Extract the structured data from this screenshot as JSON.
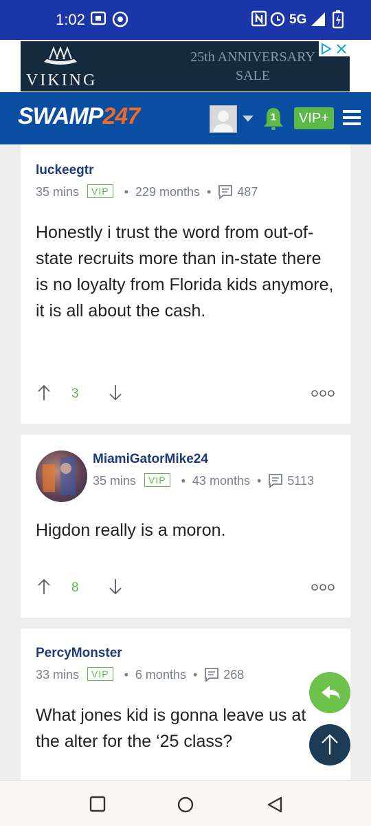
{
  "status_bar": {
    "time": "1:02",
    "network": "5G"
  },
  "ad": {
    "brand": "VIKING",
    "headline_line1": "25th ANNIVERSARY",
    "headline_line2": "SALE"
  },
  "header": {
    "logo_part1": "SWAMP",
    "logo_part2": "247",
    "notification_count": "1",
    "vip_button": "VIP+"
  },
  "posts": [
    {
      "username": "luckeegtr",
      "time_ago": "35 mins",
      "badge": "VIP",
      "tenure": "229 months",
      "post_count": "487",
      "text": "Honestly i trust the word from out-of-state recruits more than in-state there is no loyalty from Florida kids anymore, it is all about the cash.",
      "upvotes": "3"
    },
    {
      "username": "MiamiGatorMike24",
      "time_ago": "35 mins",
      "badge": "VIP",
      "tenure": "43 months",
      "post_count": "5113",
      "text": "Higdon really is a moron.",
      "upvotes": "8"
    },
    {
      "username": "PercyMonster",
      "time_ago": "33 mins",
      "badge": "VIP",
      "tenure": "6 months",
      "post_count": "268",
      "text": "What jones kid is gonna leave us at the alter for the ‘25 class?",
      "upvotes": ""
    }
  ],
  "colors": {
    "status_bar": "#1a36a8",
    "nav": "#0a4ea2",
    "accent_green": "#5db84a",
    "username": "#1b3b7c",
    "fab_top": "#1d3b56"
  }
}
